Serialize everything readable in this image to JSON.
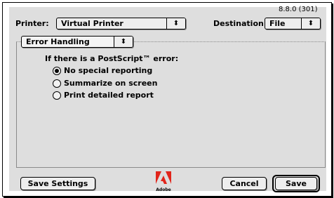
{
  "header": {
    "version": "8.8.0 (301)",
    "printer_label": "Printer:",
    "printer_value": "Virtual Printer",
    "destination_label": "Destination:",
    "destination_value": "File"
  },
  "panel": {
    "section_value": "Error Handling",
    "question": "If there is a PostScript™ error:",
    "options": [
      {
        "label": "No special reporting",
        "selected": true
      },
      {
        "label": "Summarize on screen",
        "selected": false
      },
      {
        "label": "Print detailed report",
        "selected": false
      }
    ]
  },
  "footer": {
    "save_settings_label": "Save Settings",
    "cancel_label": "Cancel",
    "save_label": "Save",
    "logo_text": "Adobe"
  },
  "colors": {
    "dialog_bg": "#dedede",
    "logo_red": "#e1251b"
  },
  "icons": {
    "popup_arrow": "up-down-arrows-icon"
  }
}
